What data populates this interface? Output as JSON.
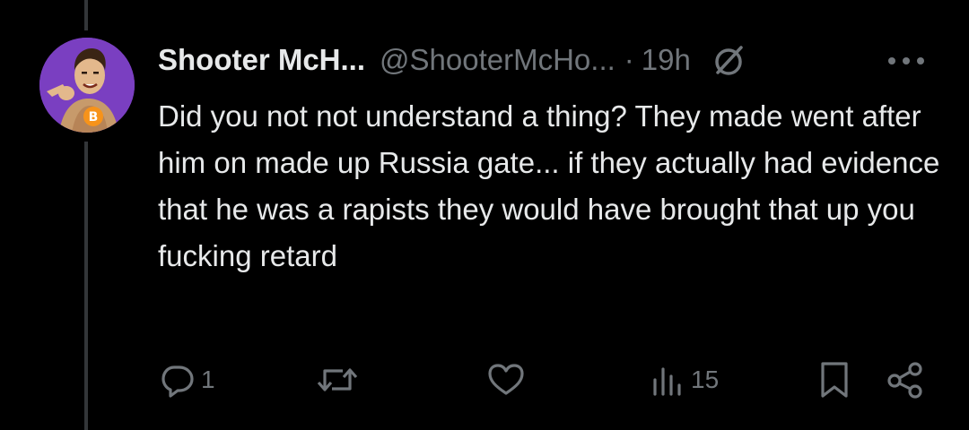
{
  "post": {
    "author": {
      "display_name": "Shooter McH...",
      "handle": "@ShooterMcHo...",
      "separator": "·",
      "time": "19h"
    },
    "text": "Did you not not understand a thing? They made went after him on made up Russia gate... if they actually had evidence that he was a rapists they would have brought that up you fucking retard",
    "actions": {
      "reply_count": "1",
      "repost_count": "",
      "like_count": "",
      "views_count": "15"
    }
  },
  "icons": {
    "avatar": "avatar-image",
    "grok": "grok-icon",
    "more": "more-dots-icon",
    "reply": "reply-icon",
    "repost": "repost-icon",
    "like": "heart-icon",
    "views": "views-bars-icon",
    "bookmark": "bookmark-icon",
    "share": "share-icon"
  },
  "colors": {
    "background": "#000000",
    "text_primary": "#e7e9ea",
    "text_secondary": "#71767b",
    "thread_line": "#333639",
    "avatar_bg": "#7a3fc1"
  }
}
